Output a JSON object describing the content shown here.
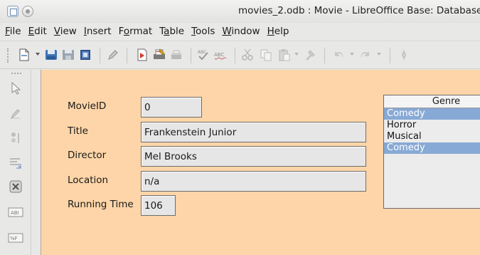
{
  "window": {
    "title": "movies_2.odb : Movie - LibreOffice Base: Database"
  },
  "menu": [
    {
      "mnemonic": "F",
      "rest": "ile"
    },
    {
      "mnemonic": "E",
      "rest": "dit"
    },
    {
      "mnemonic": "V",
      "rest": "iew"
    },
    {
      "mnemonic": "I",
      "rest": "nsert"
    },
    {
      "pre": "F",
      "mnemonic": "o",
      "rest": "rmat"
    },
    {
      "pre": "T",
      "mnemonic": "a",
      "rest": "ble"
    },
    {
      "mnemonic": "T",
      "rest": "ools"
    },
    {
      "mnemonic": "W",
      "rest": "indow"
    },
    {
      "mnemonic": "H",
      "rest": "elp"
    }
  ],
  "toolbar_icons": [
    "new-document-icon",
    "save-icon",
    "save-disabled-icon",
    "form-navigator-icon",
    "edit-pencil-icon",
    "export-pdf-icon",
    "print-icon",
    "print-disabled-icon",
    "spellcheck-icon",
    "autospell-icon",
    "cut-icon",
    "copy-icon",
    "paste-icon",
    "clone-format-icon",
    "undo-icon",
    "redo-icon",
    "navigator-icon"
  ],
  "sidebar_icons": [
    "select-pointer-icon",
    "design-mode-icon",
    "control-wizards-icon",
    "tab-order-icon",
    "close-form-icon",
    "text-box-icon",
    "formatted-field-icon"
  ],
  "form": {
    "fields": [
      {
        "label": "MovieID",
        "value": "0"
      },
      {
        "label": "Title",
        "value": "Frankenstein Junior"
      },
      {
        "label": "Director",
        "value": "Mel Brooks"
      },
      {
        "label": "Location",
        "value": "n/a"
      },
      {
        "label": "Running Time",
        "value": "106"
      }
    ],
    "genre": {
      "header": "Genre",
      "current": "Comedy",
      "items": [
        {
          "label": "Horror",
          "selected": false
        },
        {
          "label": "Musical",
          "selected": false
        },
        {
          "label": "Comedy",
          "selected": true
        }
      ]
    }
  },
  "colors": {
    "form_background": "#fdd5a8",
    "selection": "#87a9d5",
    "field_background": "#e6e6e6"
  }
}
